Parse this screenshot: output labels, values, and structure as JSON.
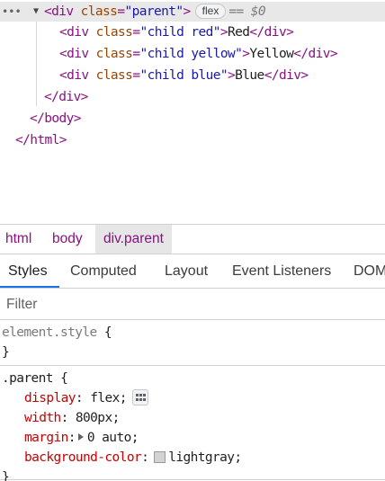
{
  "dom_tree": {
    "ellipsis": "•••",
    "line1": {
      "caret": "▼",
      "open": "<div ",
      "attr": "class",
      "eq": "=",
      "value": "\"parent\"",
      "close": ">",
      "badge": "flex",
      "ref": "== $0"
    },
    "children": [
      {
        "open": "<div ",
        "attr": "class",
        "eq": "=",
        "value": "\"child red\"",
        "close": ">",
        "text": "Red",
        "end": "</div>"
      },
      {
        "open": "<div ",
        "attr": "class",
        "eq": "=",
        "value": "\"child yellow\"",
        "close": ">",
        "text": "Yellow",
        "end": "</div>"
      },
      {
        "open": "<div ",
        "attr": "class",
        "eq": "=",
        "value": "\"child blue\"",
        "close": ">",
        "text": "Blue",
        "end": "</div>"
      }
    ],
    "close_div": "</div>",
    "close_body": "</body>",
    "close_html": "</html>"
  },
  "breadcrumb": [
    "html",
    "body",
    "div.parent"
  ],
  "tabs": [
    "Styles",
    "Computed",
    "Layout",
    "Event Listeners",
    "DOM"
  ],
  "filter": {
    "placeholder": "Filter",
    "value": ""
  },
  "element_style": {
    "selector": "element.style",
    "open": "{",
    "close": "}"
  },
  "parent_rule": {
    "selector": ".parent",
    "open": "{",
    "close": "}",
    "declarations": [
      {
        "name": "display",
        "value": "flex",
        "icon": "flex-editor-icon"
      },
      {
        "name": "width",
        "value": "800px"
      },
      {
        "name": "margin",
        "value": "0 auto",
        "icon": "expand-arrow-icon"
      },
      {
        "name": "background-color",
        "value": "lightgray",
        "swatch_color": "#d3d3d3"
      }
    ]
  },
  "colors": {
    "tag": "#881280",
    "attr_name": "#994500",
    "attr_value": "#1a1aa6",
    "css_property": "#c80000",
    "active_tab_underline": "#1a73e8",
    "selected_row": "#e8e8e8"
  }
}
